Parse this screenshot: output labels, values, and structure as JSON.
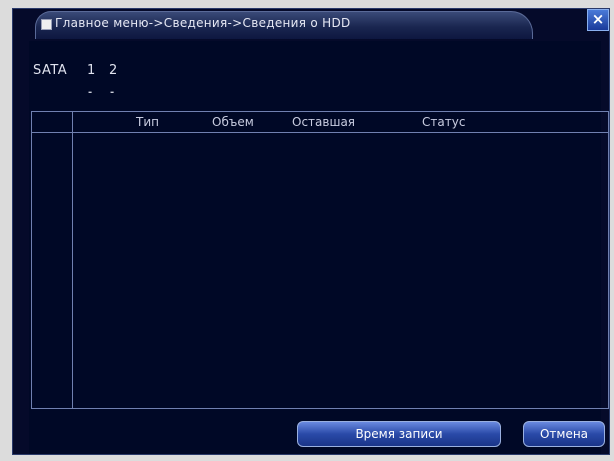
{
  "window": {
    "title": "Главное меню->Сведения->Сведения о HDD",
    "close_label": "×"
  },
  "sata": {
    "label": "SATA",
    "disks": [
      {
        "number": "1",
        "status": "-"
      },
      {
        "number": "2",
        "status": "-"
      }
    ]
  },
  "table": {
    "columns": [
      "Тип",
      "Объем",
      "Оставшая",
      "Статус"
    ]
  },
  "buttons": {
    "record_time": "Время записи",
    "cancel": "Отмена"
  },
  "colors": {
    "background": "#000826",
    "title_gradient": "#1a2650",
    "button_blue": "#2a4aa8",
    "border": "#7080b0"
  }
}
